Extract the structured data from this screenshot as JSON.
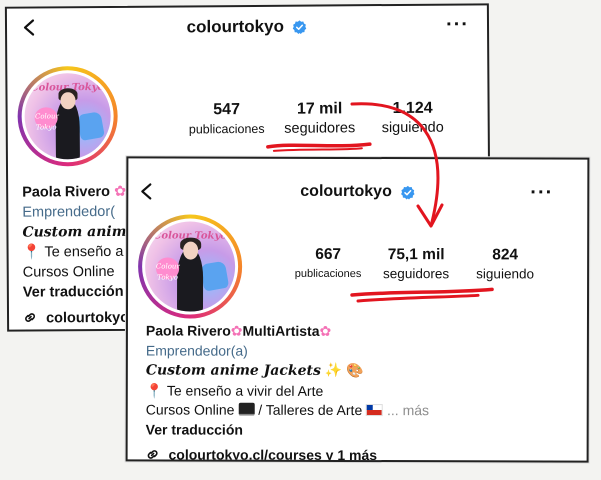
{
  "colors": {
    "verified": "#3897f0",
    "underline": "#e2151f",
    "category": "#466b8a"
  },
  "back_profile": {
    "username": "colourtokyo",
    "avatar_brand": "Colour Tokyo",
    "avatar_badge": "Colour Tokyo",
    "stats": [
      {
        "value": "547",
        "label": "publicaciones"
      },
      {
        "value": "17 mil",
        "label": "seguidores"
      },
      {
        "value": "1.124",
        "label": "siguiendo"
      }
    ],
    "name": "Paola Rivero",
    "category": "Emprendedor(",
    "line_italic": "Custom anime",
    "line_pin": "Te enseño a",
    "line_courses": "Cursos Online",
    "translate": "Ver traducción",
    "link": "colourtokyo"
  },
  "front_profile": {
    "username": "colourtokyo",
    "avatar_brand": "Colour Tokyo",
    "avatar_badge": "Colour Tokyo",
    "stats": [
      {
        "value": "667",
        "label": "publicaciones"
      },
      {
        "value": "75,1 mil",
        "label": "seguidores"
      },
      {
        "value": "824",
        "label": "siguiendo"
      }
    ],
    "name": "Paola Rivero",
    "name_suffix": "MultiArtista",
    "category": "Emprendedor(a)",
    "line_italic": "Custom anime Jackets",
    "line_pin": "Te enseño a vivir del Arte",
    "line_courses": "Cursos Online",
    "line_courses_rest": "/ Talleres de Arte",
    "more": "... más",
    "translate": "Ver traducción",
    "link": "colourtokyo.cl/courses y 1 más"
  },
  "icons": {
    "back": "chevron-left-icon",
    "more": "more-horizontal-icon",
    "verified": "verified-badge-icon",
    "link": "link-icon",
    "pin": "round-pushpin-icon",
    "laptop": "laptop-icon",
    "flag": "chile-flag-icon",
    "flower": "cherry-blossom-icon",
    "sparkle": "sparkles-icon",
    "palette": "palette-icon"
  }
}
